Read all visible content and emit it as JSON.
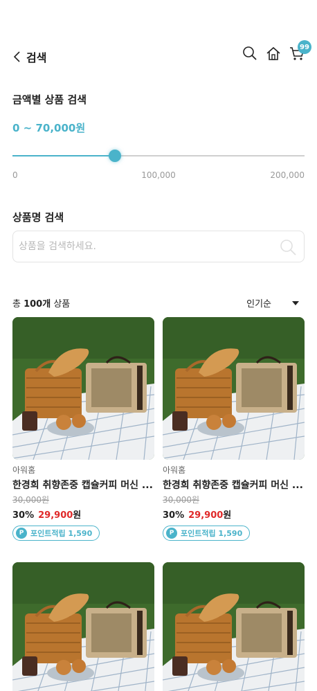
{
  "header": {
    "back_label": "검색",
    "cart_count": "99"
  },
  "price_filter": {
    "title": "금액별 상품 검색",
    "range_text": "0 ~ 70,000원",
    "value": 70000,
    "min": 0,
    "max": 200000,
    "tick_labels": [
      "0",
      "100,000",
      "200,000"
    ]
  },
  "name_search": {
    "title": "상품명 검색",
    "placeholder": "상품을 검색하세요.",
    "value": ""
  },
  "list": {
    "total_prefix": "총 ",
    "total_count": "100개",
    "total_suffix": " 상품",
    "sort_label": "인기순"
  },
  "products": [
    {
      "brand": "아워홈",
      "name": "한경희 취향존중 캡슐커피 머신 ...",
      "original_price": "30,000원",
      "discount": "30%",
      "sale_price": "29,900",
      "won": "원",
      "points": "포인트적립 1,590"
    },
    {
      "brand": "아워홈",
      "name": "한경희 취향존중 캡슐커피 머신 ...",
      "original_price": "30,000원",
      "discount": "30%",
      "sale_price": "29,900",
      "won": "원",
      "points": "포인트적립 1,590"
    },
    {
      "brand": "",
      "name": "",
      "original_price": "",
      "discount": "",
      "sale_price": "",
      "won": "",
      "points": ""
    },
    {
      "brand": "",
      "name": "",
      "original_price": "",
      "discount": "",
      "sale_price": "",
      "won": "",
      "points": ""
    }
  ],
  "colors": {
    "accent": "#4ab3ca",
    "sale": "#e02929"
  },
  "icons": {
    "back": "chevron-left-icon",
    "search": "search-icon",
    "home": "home-icon",
    "cart": "cart-icon",
    "point": "p-badge"
  },
  "point_badge_letter": "P"
}
